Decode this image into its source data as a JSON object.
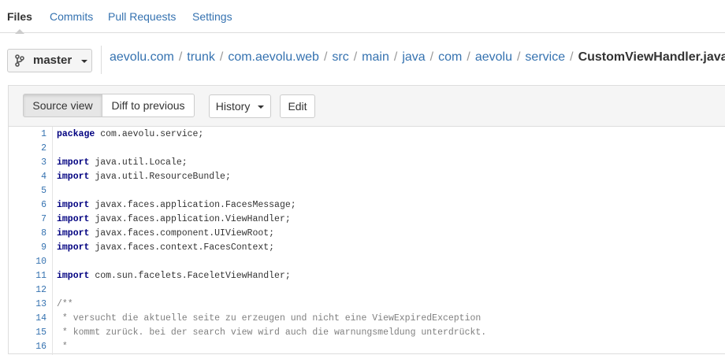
{
  "nav": {
    "tabs": [
      "Files",
      "Commits",
      "Pull Requests",
      "Settings"
    ],
    "active": "Files"
  },
  "branch": {
    "label": "master",
    "icon": "branch-icon"
  },
  "breadcrumb": {
    "segments": [
      "aevolu.com",
      "trunk",
      "com.aevolu.web",
      "src",
      "main",
      "java",
      "com",
      "aevolu",
      "service"
    ],
    "separator": "/",
    "file": "CustomViewHandler.java"
  },
  "toolbar": {
    "source_view": "Source view",
    "diff_to_previous": "Diff to previous",
    "history": "History",
    "edit": "Edit"
  },
  "code": {
    "lines": [
      {
        "n": "1",
        "kw": "package",
        "rest": " com.aevolu.service;"
      },
      {
        "n": "2",
        "kw": "",
        "rest": ""
      },
      {
        "n": "3",
        "kw": "import",
        "rest": " java.util.Locale;"
      },
      {
        "n": "4",
        "kw": "import",
        "rest": " java.util.ResourceBundle;"
      },
      {
        "n": "5",
        "kw": "",
        "rest": ""
      },
      {
        "n": "6",
        "kw": "import",
        "rest": " javax.faces.application.FacesMessage;"
      },
      {
        "n": "7",
        "kw": "import",
        "rest": " javax.faces.application.ViewHandler;"
      },
      {
        "n": "8",
        "kw": "import",
        "rest": " javax.faces.component.UIViewRoot;"
      },
      {
        "n": "9",
        "kw": "import",
        "rest": " javax.faces.context.FacesContext;"
      },
      {
        "n": "10",
        "kw": "",
        "rest": ""
      },
      {
        "n": "11",
        "kw": "import",
        "rest": " com.sun.facelets.FaceletViewHandler;"
      },
      {
        "n": "12",
        "kw": "",
        "rest": ""
      },
      {
        "n": "13",
        "kw": "",
        "comment": "/**"
      },
      {
        "n": "14",
        "kw": "",
        "comment": " * versucht die aktuelle seite zu erzeugen und nicht eine ViewExpiredException"
      },
      {
        "n": "15",
        "kw": "",
        "comment": " * kommt zurück. bei der search view wird auch die warnungsmeldung unterdrückt."
      },
      {
        "n": "16",
        "kw": "",
        "comment": " *"
      }
    ]
  },
  "colors": {
    "link": "#3572b0",
    "keyword": "#000080",
    "comment": "#808080"
  }
}
